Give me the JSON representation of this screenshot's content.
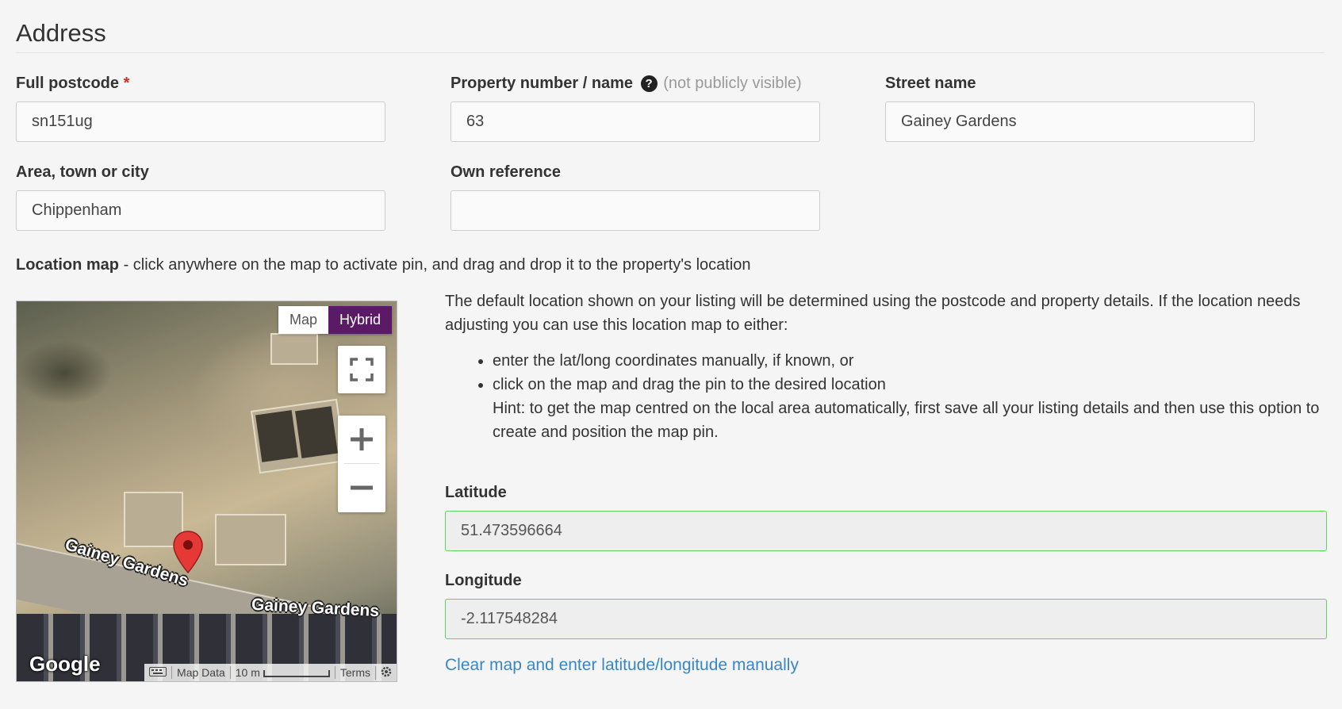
{
  "section_title": "Address",
  "fields": {
    "postcode": {
      "label": "Full postcode",
      "required_mark": "*",
      "value": "sn151ug"
    },
    "property": {
      "label": "Property number / name",
      "help_glyph": "?",
      "note": "(not publicly visible)",
      "value": "63"
    },
    "street": {
      "label": "Street name",
      "value": "Gainey Gardens"
    },
    "area": {
      "label": "Area, town or city",
      "value": "Chippenham"
    },
    "own_ref": {
      "label": "Own reference",
      "value": ""
    }
  },
  "location_map": {
    "label": "Location map",
    "instruction": " - click anywhere on the map to activate pin, and drag and drop it to the property's location",
    "map_types": {
      "map_label": "Map",
      "hybrid_label": "Hybrid",
      "selected": "Hybrid"
    },
    "road_labels": [
      "Gainey Gardens",
      "Gainey Gardens"
    ],
    "google_logo": "Google",
    "attribution": {
      "map_data": "Map Data",
      "scale": "10 m",
      "terms": "Terms"
    },
    "icons": [
      "fullscreen-icon",
      "zoom-in-icon",
      "zoom-out-icon",
      "map-pin-icon",
      "keyboard-icon",
      "settings-icon"
    ]
  },
  "description": "The default location shown on your listing will be determined using the postcode and property details. If the location needs adjusting you can use this location map to either:",
  "bullets": [
    "enter the lat/long coordinates manually, if known, or",
    "click on the map and drag the pin to the desired location"
  ],
  "hint": "Hint: to get the map centred on the local area automatically, first save all your listing details and then use this option to create and position the map pin.",
  "latitude": {
    "label": "Latitude",
    "value": "51.473596664"
  },
  "longitude": {
    "label": "Longitude",
    "value": "-2.117548284"
  },
  "clear_link": "Clear map and enter latitude/longitude manually",
  "colors": {
    "accent_purple": "#5b1a66",
    "link_blue": "#3a86c4",
    "valid_green": "#5cd65c",
    "required_red": "#c9302c"
  }
}
